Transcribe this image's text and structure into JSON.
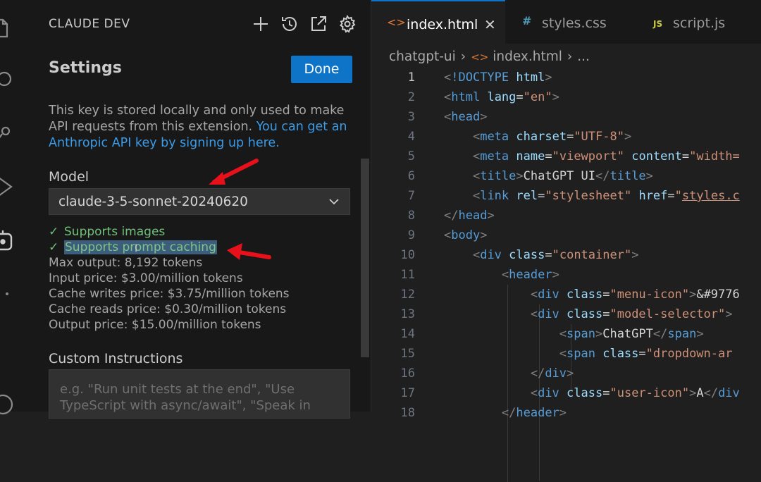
{
  "sidebar": {
    "title": "CLAUDE DEV",
    "heading": "Settings",
    "done_label": "Done",
    "key_note": "This key is stored locally and only used to make API requests from this extension.",
    "key_link": "You can get an Anthropic API key by signing up here.",
    "model_label": "Model",
    "model_value": "claude-3-5-sonnet-20240620",
    "capabilities": [
      "Supports images",
      "Supports prompt caching"
    ],
    "check_glyph": "✓",
    "info": [
      "Max output: 8,192 tokens",
      "Input price: $3.00/million tokens",
      "Cache writes price: $3.75/million tokens",
      "Cache reads price: $0.30/million tokens",
      "Output price: $15.00/million tokens"
    ],
    "custom_label": "Custom Instructions",
    "custom_placeholder": "e.g. \"Run unit tests at the end\", \"Use TypeScript with async/await\", \"Speak in"
  },
  "editor": {
    "tabs": [
      {
        "icon": "<>",
        "label": "index.html",
        "active": true
      },
      {
        "icon": "#",
        "label": "styles.css",
        "active": false
      },
      {
        "icon": "JS",
        "label": "script.js",
        "active": false
      }
    ],
    "breadcrumb": [
      "chatgpt-ui",
      "index.html",
      "..."
    ],
    "lines": [
      "1",
      "2",
      "3",
      "4",
      "5",
      "6",
      "7",
      "8",
      "9",
      "10",
      "11",
      "12",
      "13",
      "14",
      "15",
      "16",
      "17",
      "18"
    ]
  },
  "colors": {
    "accent": "#0e74c8",
    "success": "#70c07a",
    "annotation_arrow": "#e8101a"
  }
}
